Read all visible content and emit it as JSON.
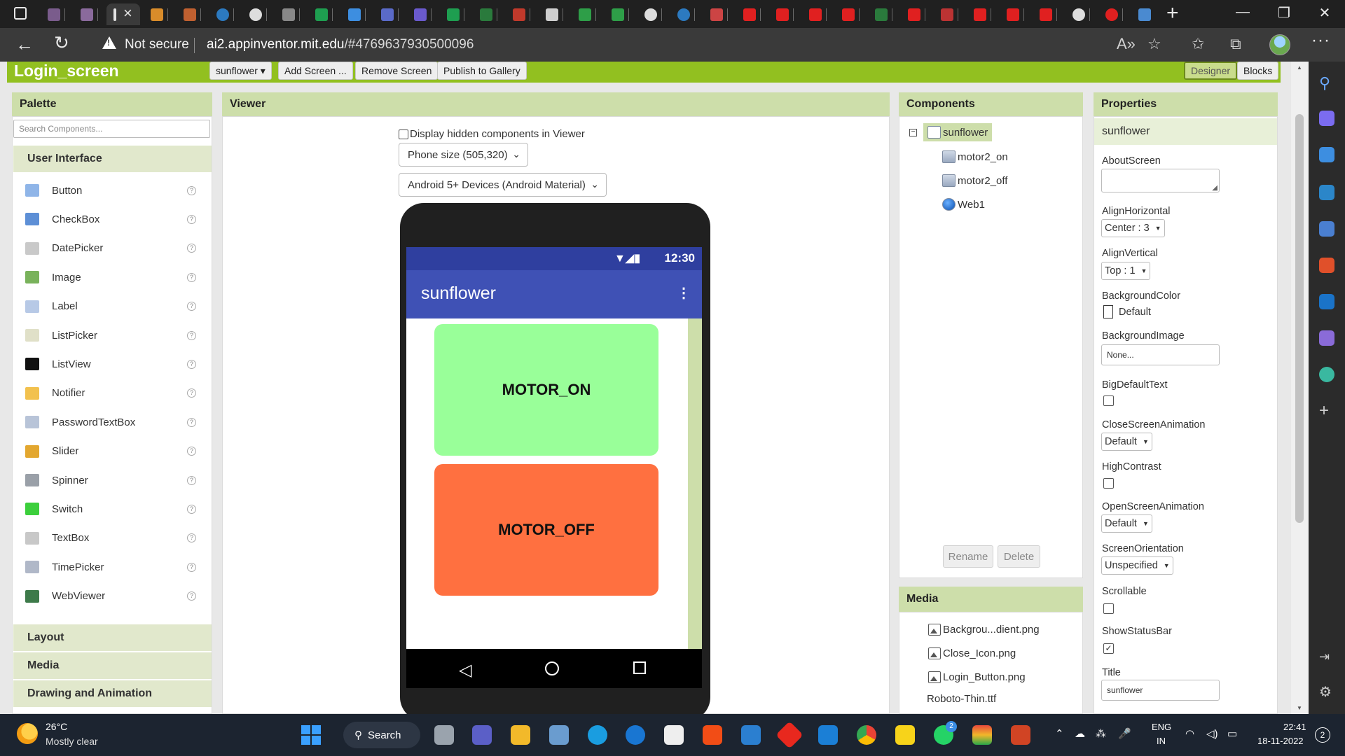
{
  "browser": {
    "url_prefix": "ai2.appinventor.mit.edu",
    "url_suffix": "/#4769637930500096",
    "security_label": "Not secure"
  },
  "header": {
    "screen_name": "Login_screen",
    "screen_dropdown": "sunflower ▾",
    "add_screen": "Add Screen ...",
    "remove_screen": "Remove Screen",
    "publish": "Publish to Gallery",
    "designer": "Designer",
    "blocks": "Blocks"
  },
  "palette": {
    "title": "Palette",
    "search_placeholder": "Search Components...",
    "category_user_interface": "User Interface",
    "items": [
      {
        "label": "Button",
        "icon": "button-icon",
        "color": "#8fb5e8"
      },
      {
        "label": "CheckBox",
        "icon": "checkbox-icon",
        "color": "#5d8fd6"
      },
      {
        "label": "DatePicker",
        "icon": "datepicker-icon",
        "color": "#c9c9c9"
      },
      {
        "label": "Image",
        "icon": "image-icon",
        "color": "#79b25b"
      },
      {
        "label": "Label",
        "icon": "label-icon",
        "color": "#b7c9e6"
      },
      {
        "label": "ListPicker",
        "icon": "listpicker-icon",
        "color": "#e0e0c8"
      },
      {
        "label": "ListView",
        "icon": "listview-icon",
        "color": "#111111"
      },
      {
        "label": "Notifier",
        "icon": "notifier-icon",
        "color": "#f2c14e"
      },
      {
        "label": "PasswordTextBox",
        "icon": "passwordtextbox-icon",
        "color": "#b8c4d8"
      },
      {
        "label": "Slider",
        "icon": "slider-icon",
        "color": "#e3a72f"
      },
      {
        "label": "Spinner",
        "icon": "spinner-icon",
        "color": "#9aa0a8"
      },
      {
        "label": "Switch",
        "icon": "switch-icon",
        "color": "#3ccf3c"
      },
      {
        "label": "TextBox",
        "icon": "textbox-icon",
        "color": "#c8c8c8"
      },
      {
        "label": "TimePicker",
        "icon": "timepicker-icon",
        "color": "#b0b8c8"
      },
      {
        "label": "WebViewer",
        "icon": "webviewer-icon",
        "color": "#3d7a4a"
      }
    ],
    "categories": [
      "Layout",
      "Media",
      "Drawing and Animation"
    ]
  },
  "viewer": {
    "title": "Viewer",
    "display_hidden": "Display hidden components in Viewer",
    "phone_size": "Phone size (505,320)",
    "theme": "Android 5+ Devices (Android Material)",
    "status_time": "12:30",
    "app_title": "sunflower",
    "motor_on": "MOTOR_ON",
    "motor_off": "MOTOR_OFF",
    "motor_on_color": "#99ff99",
    "motor_off_color": "#ff7040"
  },
  "components": {
    "title": "Components",
    "root": "sunflower",
    "items": [
      "motor2_on",
      "motor2_off",
      "Web1"
    ],
    "rename": "Rename",
    "delete": "Delete"
  },
  "media": {
    "title": "Media",
    "files": [
      "Backgrou...dient.png",
      "Close_Icon.png",
      "Login_Button.png",
      "Roboto-Thin.ttf"
    ]
  },
  "properties": {
    "title": "Properties",
    "component": "sunflower",
    "about_screen_label": "AboutScreen",
    "align_h_label": "AlignHorizontal",
    "align_h_value": "Center : 3",
    "align_v_label": "AlignVertical",
    "align_v_value": "Top : 1",
    "bg_color_label": "BackgroundColor",
    "bg_color_value": "Default",
    "bg_image_label": "BackgroundImage",
    "bg_image_value": "None...",
    "big_text_label": "BigDefaultText",
    "close_anim_label": "CloseScreenAnimation",
    "close_anim_value": "Default",
    "high_contrast_label": "HighContrast",
    "open_anim_label": "OpenScreenAnimation",
    "open_anim_value": "Default",
    "orientation_label": "ScreenOrientation",
    "orientation_value": "Unspecified",
    "scrollable_label": "Scrollable",
    "show_status_label": "ShowStatusBar",
    "title_label": "Title",
    "title_value": "sunflower"
  },
  "taskbar": {
    "temperature": "26°C",
    "weather": "Mostly clear",
    "search": "Search",
    "lang1": "ENG",
    "lang2": "IN",
    "time": "22:41",
    "date": "18-11-2022",
    "notifications": "2",
    "whatsapp_badge": "2"
  }
}
